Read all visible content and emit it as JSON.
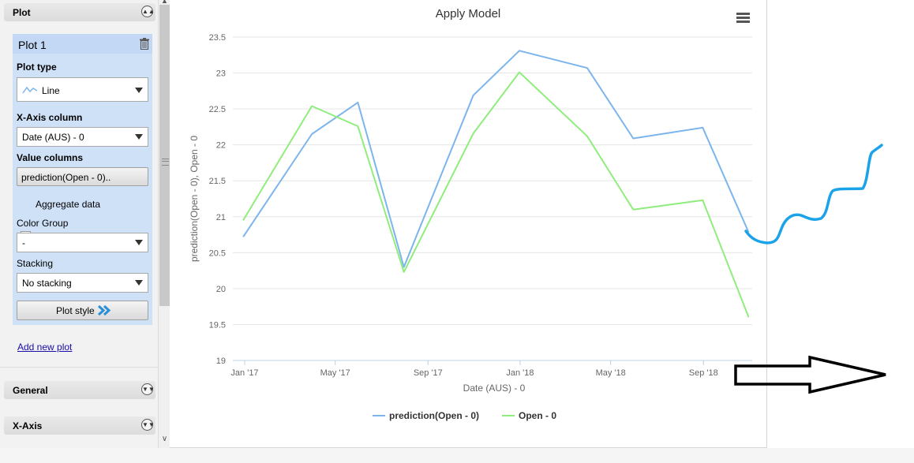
{
  "sidebar": {
    "plot_section_title": "Plot",
    "plot_name": "Plot 1",
    "plot_type_label": "Plot type",
    "plot_type_value": "Line",
    "x_axis_column_label": "X-Axis column",
    "x_axis_column_value": "Date (AUS) - 0",
    "value_columns_label": "Value columns",
    "value_columns_button": "prediction(Open - 0)..",
    "aggregate_label": "Aggregate data",
    "aggregate_checked": false,
    "color_group_label": "Color Group",
    "color_group_value": "-",
    "stacking_label": "Stacking",
    "stacking_value": "No stacking",
    "plot_style_button": "Plot style",
    "add_new_plot_link": "Add new plot",
    "general_section_title": "General",
    "x_axis_section_title": "X-Axis"
  },
  "colors": {
    "prediction_series": "#7cb5ec",
    "open_series": "#90ed7d",
    "annotation_curve": "#1aa3e8",
    "annotation_arrow": "#000000"
  },
  "chart_data": {
    "type": "line",
    "title": "Apply Model",
    "xlabel": "Date (AUS) - 0",
    "ylabel": "prediction(Open - 0), Open - 0",
    "x_ticks": [
      "Jan '17",
      "May '17",
      "Sep '17",
      "Jan '18",
      "May '18",
      "Sep '18"
    ],
    "ylim": [
      19,
      23.5
    ],
    "y_ticks": [
      19,
      19.5,
      20,
      20.5,
      21,
      21.5,
      22,
      22.5,
      23,
      23.5
    ],
    "grid": true,
    "legend_position": "bottom",
    "x": [
      "2016-12-30",
      "2017-03-31",
      "2017-05-31",
      "2017-07-31",
      "2017-10-31",
      "2017-12-31",
      "2018-03-31",
      "2018-05-31",
      "2018-08-31",
      "2018-10-31"
    ],
    "series": [
      {
        "name": "prediction(Open - 0)",
        "values": [
          20.72,
          22.15,
          22.59,
          20.3,
          22.69,
          23.31,
          23.07,
          22.09,
          22.24,
          20.78
        ]
      },
      {
        "name": "Open - 0",
        "values": [
          20.95,
          22.54,
          22.26,
          20.23,
          22.16,
          23.01,
          22.12,
          21.1,
          21.23,
          19.6
        ]
      }
    ]
  }
}
